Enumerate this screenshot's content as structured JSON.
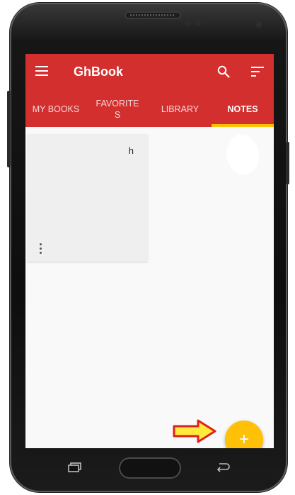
{
  "appbar": {
    "title": "GhBook",
    "background_color": "#d32f2f",
    "icons": [
      "menu-icon",
      "search-icon",
      "sort-icon"
    ]
  },
  "tabs": [
    {
      "label": "MY BOOKS",
      "active": false
    },
    {
      "label": "FAVORITE\nS",
      "active": false
    },
    {
      "label": "LIBRARY",
      "active": false
    },
    {
      "label": "NOTES",
      "active": true
    }
  ],
  "tab_indicator_color": "#ffc107",
  "notes": [
    {
      "text": "h"
    }
  ],
  "fab": {
    "label": "+",
    "color": "#ffc107"
  },
  "annotation_arrow_colors": {
    "fill": "#ffeb3b",
    "stroke": "#e02020"
  }
}
